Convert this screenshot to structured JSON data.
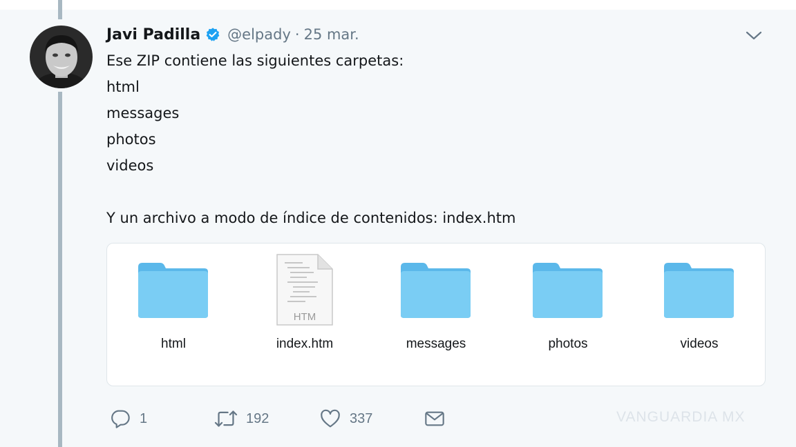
{
  "tweet": {
    "author_name": "Javi Padilla",
    "handle": "@elpady",
    "separator": "·",
    "date": "25 mar.",
    "lines": [
      "Ese ZIP contiene las siguientes carpetas:",
      "html",
      "messages",
      "photos",
      "videos",
      "Y un archivo a modo de índice de contenidos: index.htm"
    ]
  },
  "attachment": {
    "items": [
      {
        "label": "html",
        "kind": "folder-icon"
      },
      {
        "label": "index.htm",
        "kind": "htm-file-icon",
        "file_badge": "HTM"
      },
      {
        "label": "messages",
        "kind": "folder-icon"
      },
      {
        "label": "photos",
        "kind": "folder-icon"
      },
      {
        "label": "videos",
        "kind": "folder-icon"
      }
    ]
  },
  "actions": {
    "replies": "1",
    "retweets": "192",
    "likes": "337"
  },
  "watermark": "VANGUARDIA MX",
  "colors": {
    "background": "#f5f8fa",
    "thread_line": "#a8b8c2",
    "verified": "#1da1f2",
    "muted": "#657786",
    "folder": "#6fc4ef"
  }
}
